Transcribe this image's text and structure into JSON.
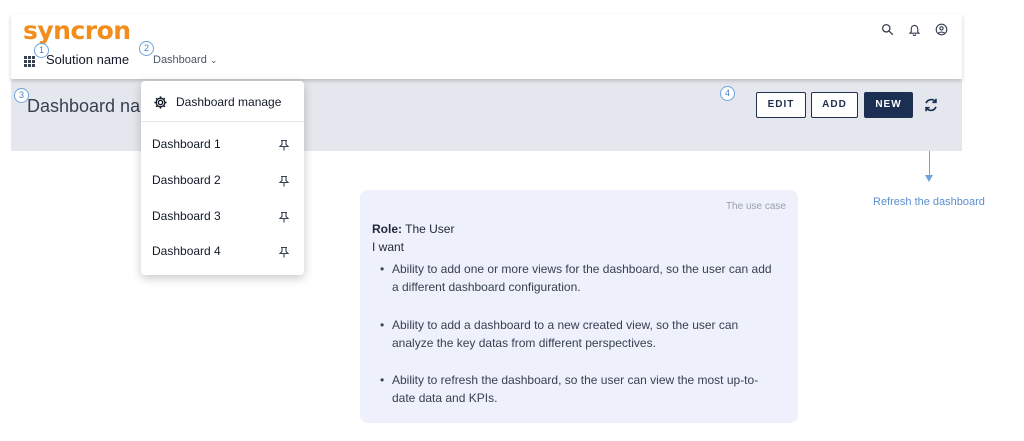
{
  "header": {
    "logo": "syncron",
    "solution_name": "Solution name",
    "dashboard_select": "Dashboard",
    "icons": [
      "search-icon",
      "bell-icon",
      "account-icon"
    ]
  },
  "badges": {
    "b1": "1",
    "b2": "2",
    "b3": "3",
    "b4": "4"
  },
  "page": {
    "title": "Dashboard name",
    "actions": {
      "edit": "EDIT",
      "add": "ADD",
      "new": "NEW"
    },
    "refresh_icon": "refresh-icon"
  },
  "dropdown": {
    "manage_label": "Dashboard manage",
    "items": [
      {
        "label": "Dashboard 1"
      },
      {
        "label": "Dashboard 2"
      },
      {
        "label": "Dashboard 3"
      },
      {
        "label": "Dashboard 4"
      }
    ]
  },
  "annotation": {
    "refresh_note": "Refresh the dashboard"
  },
  "use_case": {
    "caption": "The use case",
    "role_label": "Role:",
    "role_value": "The User",
    "want": "I want",
    "bullets": [
      "Ability to add one or more views for the dashboard, so the user can add a different dashboard configuration.",
      "Ability to add a dashboard to a new created view, so the user can analyze the key datas from different perspectives.",
      "Ability to refresh the dashboard, so the user can view the most up-to-date data and KPIs."
    ]
  },
  "colors": {
    "brand": "#f28c1b",
    "primary_button": "#1b2f52",
    "annotation": "#6fa3dc",
    "usecase_bg": "#eef0fb"
  }
}
